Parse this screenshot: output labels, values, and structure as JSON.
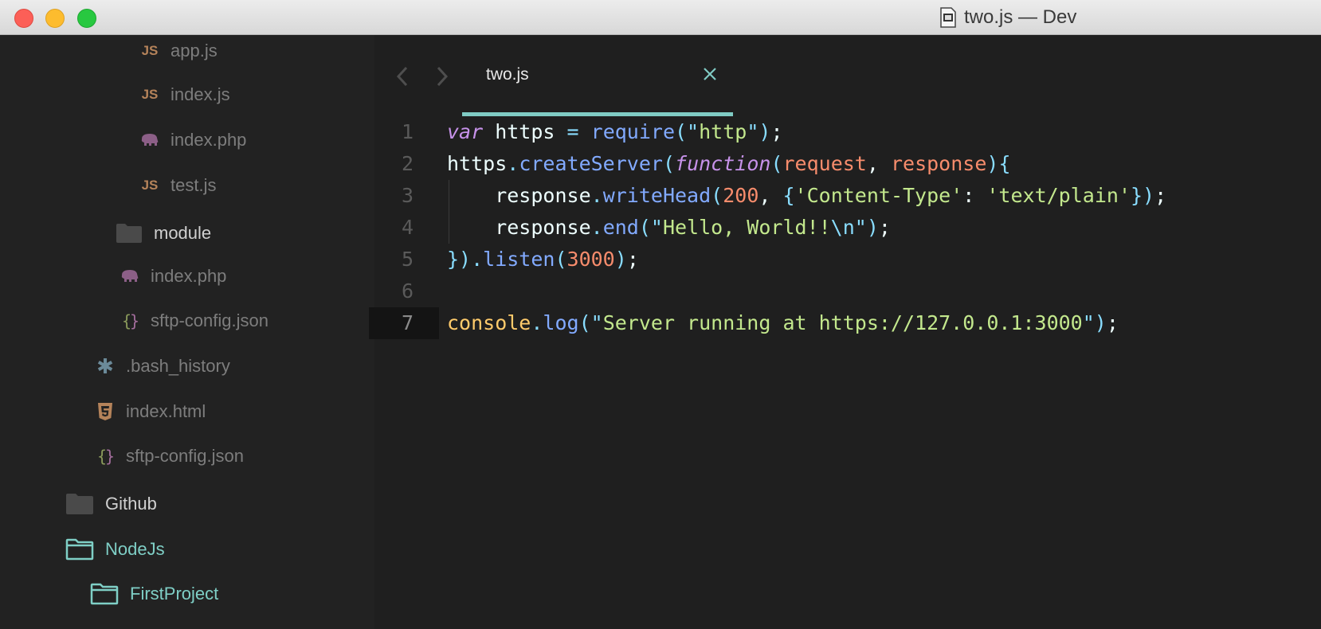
{
  "window": {
    "title": "two.js — Dev"
  },
  "sidebar": {
    "items": [
      {
        "label": "app.js",
        "icon": "js-icon"
      },
      {
        "label": "index.js",
        "icon": "js-icon"
      },
      {
        "label": "index.php",
        "icon": "php-elephant-icon"
      },
      {
        "label": "test.js",
        "icon": "js-icon"
      },
      {
        "label": "module",
        "icon": "folder-icon"
      },
      {
        "label": "index.php",
        "icon": "php-elephant-icon"
      },
      {
        "label": "sftp-config.json",
        "icon": "json-braces-icon"
      },
      {
        "label": ".bash_history",
        "icon": "asterisk-icon"
      },
      {
        "label": "index.html",
        "icon": "html5-icon"
      },
      {
        "label": "sftp-config.json",
        "icon": "json-braces-icon"
      },
      {
        "label": "Github",
        "icon": "folder-icon"
      },
      {
        "label": "NodeJs",
        "icon": "folder-open-icon"
      },
      {
        "label": "FirstProject",
        "icon": "folder-open-icon"
      }
    ]
  },
  "editor": {
    "tab": {
      "label": "two.js",
      "close": "×"
    },
    "current_line": 7,
    "lines": [
      {
        "n": "1",
        "tokens": [
          [
            "kw",
            "var"
          ],
          [
            "var",
            " https "
          ],
          [
            "punc",
            "="
          ],
          [
            "var",
            " "
          ],
          [
            "fn",
            "require"
          ],
          [
            "punc",
            "(\""
          ],
          [
            "str",
            "http"
          ],
          [
            "punc",
            "\")"
          ],
          [
            "var",
            ";"
          ]
        ]
      },
      {
        "n": "2",
        "tokens": [
          [
            "var",
            "https"
          ],
          [
            "punc",
            "."
          ],
          [
            "fn",
            "createServer"
          ],
          [
            "punc",
            "("
          ],
          [
            "kw",
            "function"
          ],
          [
            "punc",
            "("
          ],
          [
            "param",
            "request"
          ],
          [
            "var",
            ", "
          ],
          [
            "param",
            "response"
          ],
          [
            "punc",
            "){"
          ]
        ]
      },
      {
        "n": "3",
        "tokens": [
          [
            "var",
            "    response"
          ],
          [
            "punc",
            "."
          ],
          [
            "fn",
            "writeHead"
          ],
          [
            "punc",
            "("
          ],
          [
            "num",
            "200"
          ],
          [
            "var",
            ", "
          ],
          [
            "punc",
            "{"
          ],
          [
            "str",
            "'Content-Type'"
          ],
          [
            "var",
            ": "
          ],
          [
            "str",
            "'text/plain'"
          ],
          [
            "punc",
            "})"
          ],
          [
            "var",
            ";"
          ]
        ]
      },
      {
        "n": "4",
        "tokens": [
          [
            "var",
            "    response"
          ],
          [
            "punc",
            "."
          ],
          [
            "fn",
            "end"
          ],
          [
            "punc",
            "(\""
          ],
          [
            "str",
            "Hello, World!!"
          ],
          [
            "punc",
            "\\n\")"
          ],
          [
            "var",
            ";"
          ]
        ]
      },
      {
        "n": "5",
        "tokens": [
          [
            "punc",
            "})."
          ],
          [
            "fn",
            "listen"
          ],
          [
            "punc",
            "("
          ],
          [
            "num",
            "3000"
          ],
          [
            "punc",
            ")"
          ],
          [
            "var",
            ";"
          ]
        ]
      },
      {
        "n": "6",
        "tokens": []
      },
      {
        "n": "7",
        "tokens": [
          [
            "obj",
            "console"
          ],
          [
            "punc",
            "."
          ],
          [
            "fn",
            "log"
          ],
          [
            "punc",
            "(\""
          ],
          [
            "str",
            "Server running at https://127.0.0.1:3000"
          ],
          [
            "punc",
            "\")"
          ],
          [
            "var",
            ";"
          ]
        ]
      }
    ]
  },
  "colors": {
    "accent": "#80cbc4",
    "background": "#1f1f1f",
    "sidebar": "#222222"
  }
}
